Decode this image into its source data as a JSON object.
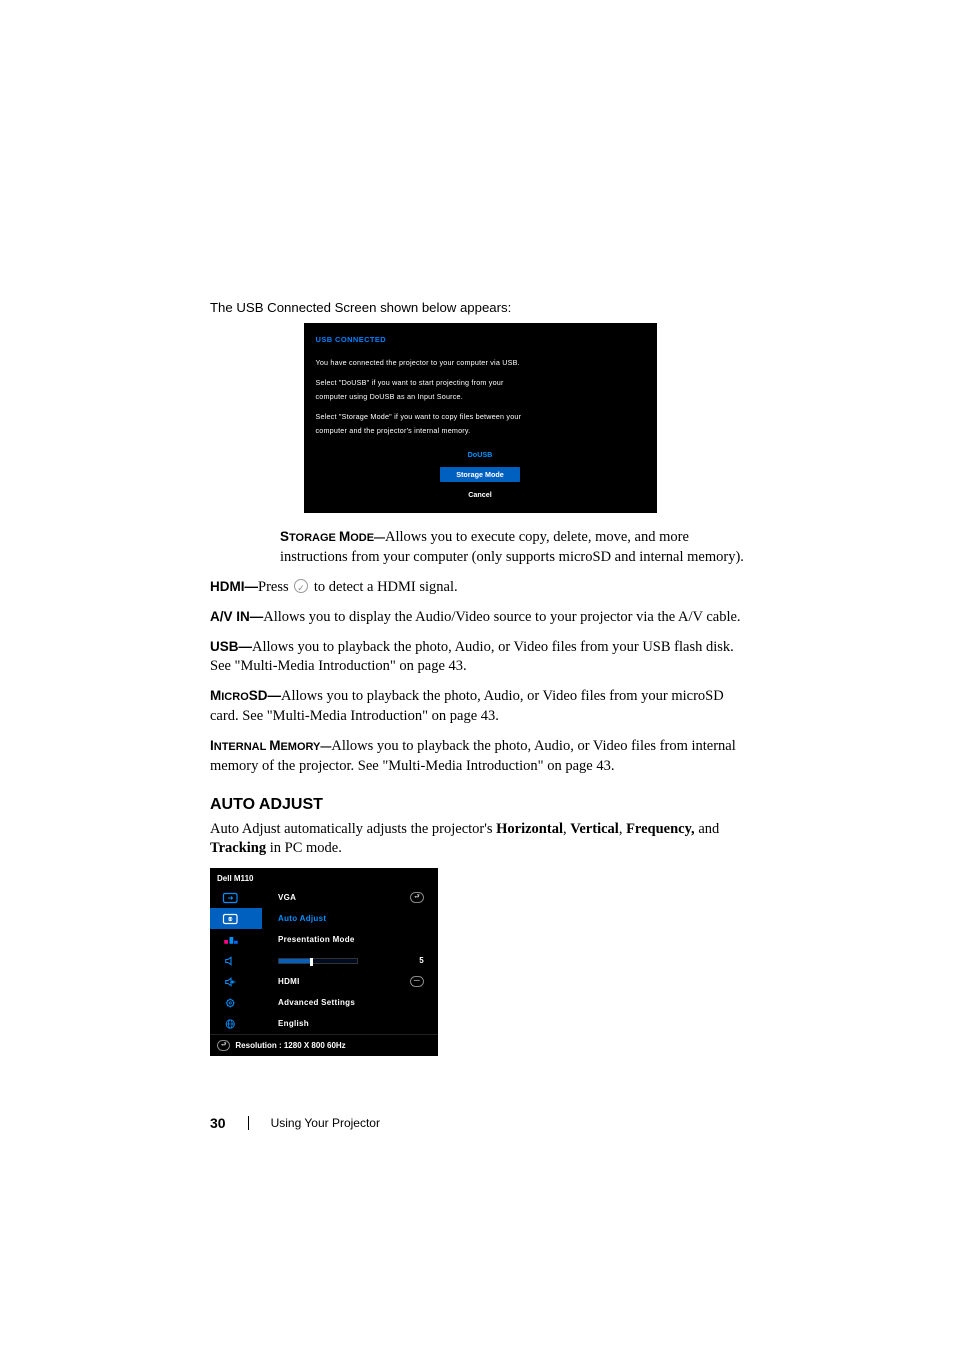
{
  "intro_line": "The USB Connected Screen shown below appears:",
  "usb_screen": {
    "title": "USB CONNECTED",
    "p1": "You have connected the projector to your computer via USB.",
    "p2a": "Select \"DoUSB\" if you want to start projecting from your",
    "p2b": "computer using DoUSB as an Input Source.",
    "p3a": "Select \"Storage Mode\" if you want to copy files between your",
    "p3b": "computer and the projector's internal memory.",
    "btn_dousb": "DoUSB",
    "btn_storage": "Storage Mode",
    "btn_cancel": "Cancel"
  },
  "storage_mode": {
    "label_big": "S",
    "label_sc": "TORAGE ",
    "label_big2": "M",
    "label_sc2": "ODE—",
    "text": "Allows you to execute copy, delete, move, and more instructions from your computer (only supports microSD and internal memory)."
  },
  "hdmi": {
    "label": "HDMI—",
    "text_before": "Press ",
    "text_after": " to detect a HDMI signal."
  },
  "avin": {
    "label": "A/V IN—",
    "text": "Allows you to display the Audio/Video source to your projector via the A/V cable."
  },
  "usb": {
    "label": "USB—",
    "text": "Allows you to playback the photo, Audio, or Video files from your USB flash disk. See \"Multi-Media Introduction\" on page 43."
  },
  "microsd": {
    "label_big": "M",
    "label_sc": "ICRO",
    "label_big2": "SD—",
    "text": "Allows you to playback the photo, Audio, or Video files from your microSD card. See \"Multi-Media Introduction\" on page 43."
  },
  "intmem": {
    "label_big": "I",
    "label_sc": "NTERNAL ",
    "label_big2": "M",
    "label_sc2": "EMORY—",
    "text": "Allows you to playback the photo, Audio, or Video files from internal memory of the projector. See \"Multi-Media Introduction\" on page 43."
  },
  "auto_adjust": {
    "heading": "AUTO ADJUST",
    "text_a": "Auto Adjust automatically adjusts the projector's ",
    "b1": "Horizontal",
    "sep1": ", ",
    "b2": "Vertical",
    "sep2": ", ",
    "b3": "Frequency,",
    "text_b": " and ",
    "b4": "Tracking",
    "text_c": " in PC mode."
  },
  "menu": {
    "header": "Dell  M110",
    "rows": {
      "vga": "VGA",
      "auto_adjust": "Auto Adjust",
      "presentation": "Presentation Mode",
      "slider_value": "5",
      "hdmi": "HDMI",
      "adv": "Advanced Settings",
      "lang": "English"
    },
    "footer": "Resolution : 1280 X 800 60Hz"
  },
  "footer": {
    "page_num": "30",
    "section": "Using Your Projector"
  },
  "chart_data": {
    "type": "table",
    "note": "On-screen projector menu listing",
    "items": [
      {
        "label": "VGA",
        "type": "input-source"
      },
      {
        "label": "Auto Adjust",
        "type": "action",
        "selected": true
      },
      {
        "label": "Presentation Mode",
        "type": "mode"
      },
      {
        "label": "(slider)",
        "value": 5
      },
      {
        "label": "HDMI",
        "type": "input-source"
      },
      {
        "label": "Advanced Settings",
        "type": "submenu"
      },
      {
        "label": "English",
        "type": "language"
      }
    ],
    "status_bar": "Resolution : 1280 X 800 60Hz"
  }
}
